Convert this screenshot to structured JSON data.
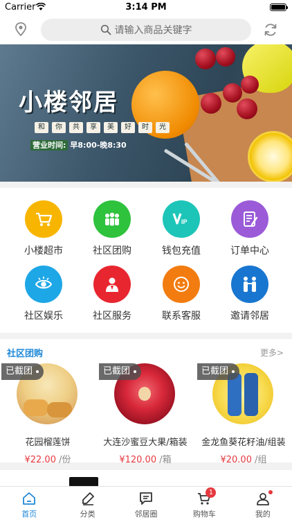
{
  "status_bar": {
    "carrier": "Carrier",
    "time": "3:14 PM"
  },
  "search": {
    "placeholder": "请输入商品关键字"
  },
  "banner": {
    "title": "小楼邻居",
    "slogan": [
      "和",
      "你",
      "共",
      "享",
      "美",
      "好",
      "时",
      "光"
    ],
    "hours_label": "营业时间:",
    "hours_value": "早8:00-晚8:30"
  },
  "menu": {
    "items": [
      {
        "label": "小楼超市",
        "icon": "cart-icon",
        "color": "#f7b500"
      },
      {
        "label": "社区团购",
        "icon": "group-icon",
        "color": "#2ec23d"
      },
      {
        "label": "钱包充值",
        "icon": "vip-icon",
        "color": "#1cc5b8"
      },
      {
        "label": "订单中心",
        "icon": "order-icon",
        "color": "#9b5bd8"
      },
      {
        "label": "社区娱乐",
        "icon": "eye-icon",
        "color": "#1ea7e6"
      },
      {
        "label": "社区服务",
        "icon": "service-icon",
        "color": "#e8262f"
      },
      {
        "label": "联系客服",
        "icon": "smile-icon",
        "color": "#f27c10"
      },
      {
        "label": "邀请邻居",
        "icon": "invite-icon",
        "color": "#1876d0"
      }
    ]
  },
  "group_buy": {
    "title": "社区团购",
    "more": "更多>",
    "products": [
      {
        "badge": "已截团",
        "name": "花园榴莲饼",
        "price": "¥22.00",
        "unit": "/份"
      },
      {
        "badge": "已截团",
        "name": "大连沙蜜豆大果/箱装",
        "price": "¥120.00",
        "unit": "/箱"
      },
      {
        "badge": "已截团",
        "name": "金龙鱼葵花籽油/组装",
        "price": "¥20.00",
        "unit": "/组"
      }
    ]
  },
  "tabbar": {
    "tabs": [
      {
        "label": "首页",
        "icon": "home-icon",
        "active": true
      },
      {
        "label": "分类",
        "icon": "category-icon"
      },
      {
        "label": "邻居圈",
        "icon": "chat-icon"
      },
      {
        "label": "购物车",
        "icon": "cart-icon",
        "badge": "1"
      },
      {
        "label": "我的",
        "icon": "profile-icon"
      }
    ]
  },
  "colors": {
    "accent": "#1e88d8",
    "price": "#e5383f"
  }
}
